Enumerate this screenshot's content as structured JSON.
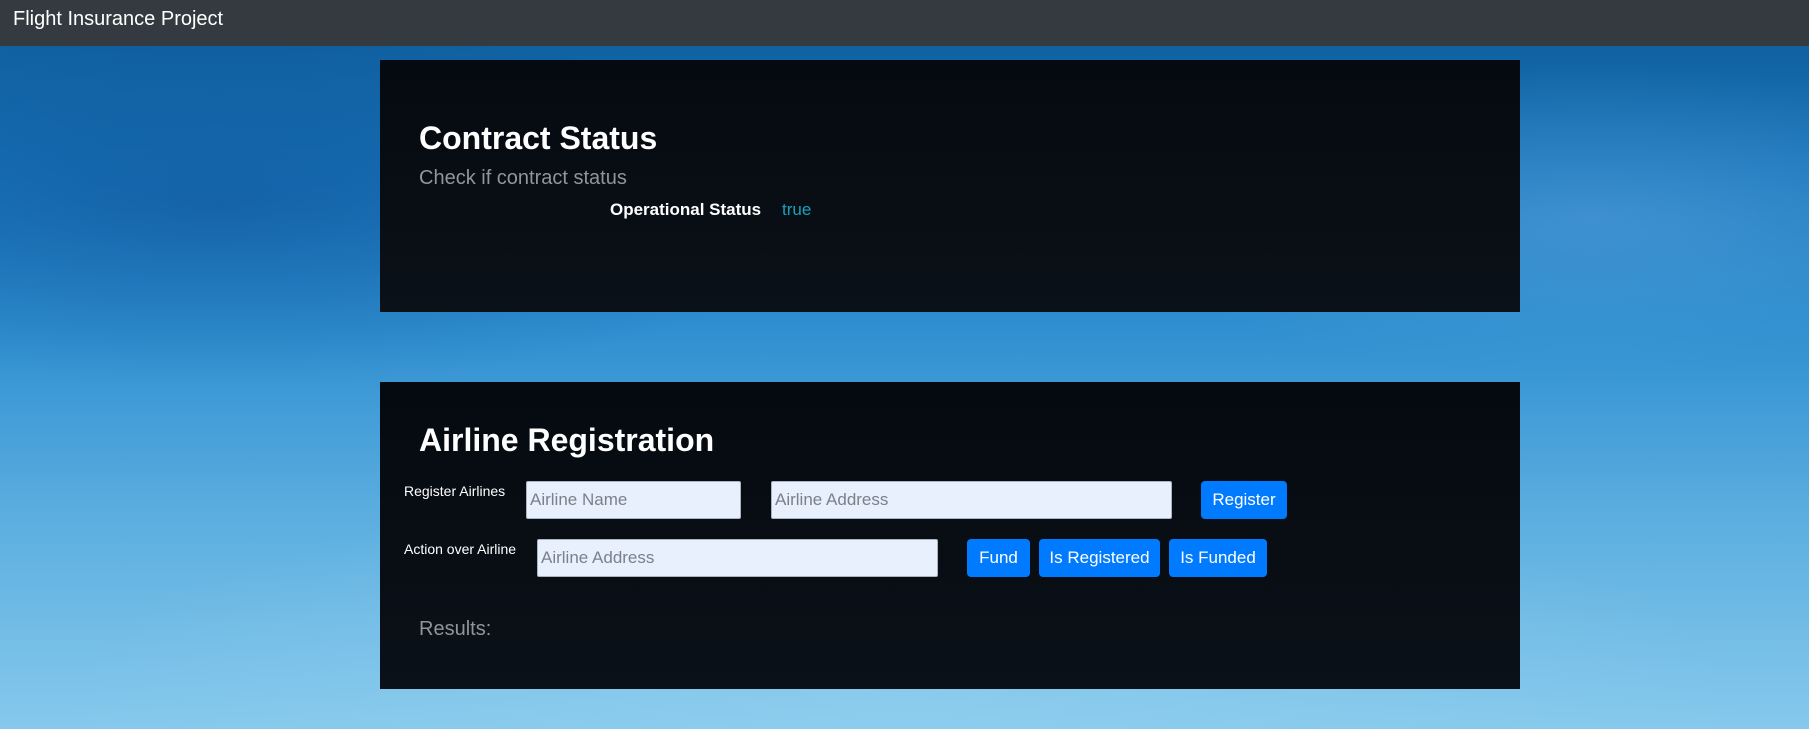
{
  "navbar": {
    "brand": "Flight Insurance Project"
  },
  "contract_status": {
    "title": "Contract Status",
    "subtitle": "Check if contract status",
    "operational_label": "Operational Status",
    "operational_value": "true"
  },
  "airline_registration": {
    "title": "Airline Registration",
    "register_row": {
      "label": "Register Airlines",
      "name_input": {
        "placeholder": "Airline Name",
        "value": ""
      },
      "address_input": {
        "placeholder": "Airline Address",
        "value": ""
      },
      "register_button": "Register"
    },
    "action_row": {
      "label": "Action over Airline",
      "address_input": {
        "placeholder": "Airline Address",
        "value": ""
      },
      "fund_button": "Fund",
      "is_registered_button": "Is Registered",
      "is_funded_button": "Is Funded"
    },
    "results_label": "Results:"
  },
  "colors": {
    "navbar": "#343a40",
    "card": "#070c12",
    "primary_button": "#007bff",
    "status_value": "#17a2b8",
    "muted_text": "#8e959c"
  }
}
